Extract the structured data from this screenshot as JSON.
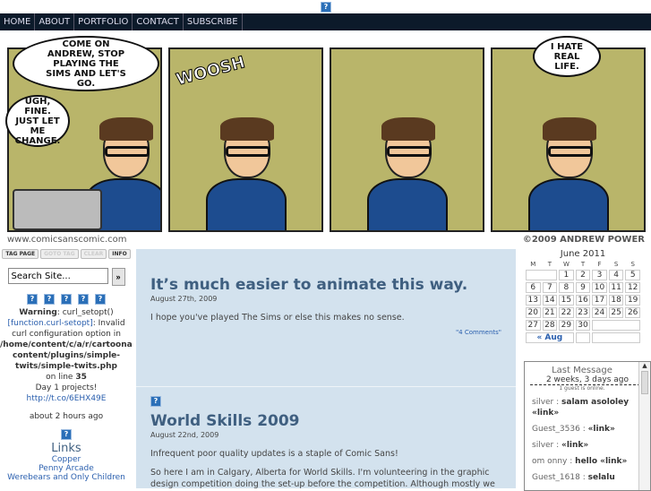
{
  "nav": [
    "HOME",
    "ABOUT",
    "PORTFOLIO",
    "CONTACT",
    "SUBSCRIBE"
  ],
  "comic": {
    "bubble1": "COME ON ANDREW, STOP PLAYING THE SIMS AND LET'S GO.",
    "bubble2": "UGH, FINE. JUST LET ME CHANGE.",
    "sfx": "WOOSH",
    "bubble4": "I HATE REAL LIFE.",
    "site": "www.comicsanscomic.com",
    "copyright": "©2009 ANDREW POWER"
  },
  "toolbar": [
    "TAG PAGE",
    "GOTO TAG",
    "CLEAR",
    "INFO"
  ],
  "search": {
    "placeholder": "Search Site...",
    "button": "»"
  },
  "twitter": {
    "warning_label": "Warning",
    "warning_fn": ": curl_setopt()",
    "fn_link": "[function.curl-setopt]",
    "msg": ": Invalid curl configuration option in",
    "path": "/home/content/c/a/r/cartoonand content/plugins/simple-twits/simple-twits.php",
    "line_label": "on line",
    "line": "35",
    "tweet": "Day 1 projects!",
    "tweet_link": "http://t.co/6EHX49E",
    "time": "about 2 hours ago"
  },
  "links": {
    "title": "Links",
    "items": [
      "Copper",
      "Penny Arcade",
      "Werebears and Only Children"
    ]
  },
  "posts": [
    {
      "title": "It’s much easier to animate this way.",
      "date": "August 27th, 2009",
      "body": "I hope you've played The Sims or else this makes no sense.",
      "comments": "\"4 Comments\""
    },
    {
      "title": "World Skills 2009",
      "date": "August 22nd, 2009",
      "body": "Infrequent poor quality updates is a staple of Comic Sans!",
      "body2": "So here I am in Calgary, Alberta for World Skills. I'm volunteering in the graphic design competition doing the set-up before the competition. Although mostly we"
    }
  ],
  "calendar": {
    "title": "June 2011",
    "days": [
      "M",
      "T",
      "W",
      "T",
      "F",
      "S",
      "S"
    ],
    "weeks": [
      [
        "",
        "",
        "1",
        "2",
        "3",
        "4",
        "5"
      ],
      [
        "6",
        "7",
        "8",
        "9",
        "10",
        "11",
        "12"
      ],
      [
        "13",
        "14",
        "15",
        "16",
        "17",
        "18",
        "19"
      ],
      [
        "20",
        "21",
        "22",
        "23",
        "24",
        "25",
        "26"
      ],
      [
        "27",
        "28",
        "29",
        "30",
        "",
        "",
        ""
      ]
    ],
    "prev": "« Aug"
  },
  "chat": {
    "title": "Last Message",
    "ago": "2 weeks, 3 days ago",
    "online": "1 guest is online.",
    "messages": [
      {
        "user": "silver :",
        "text": "salam asololey «link»"
      },
      {
        "user": "Guest_3536 :",
        "text": "«link»"
      },
      {
        "user": "silver :",
        "text": "«link»"
      },
      {
        "user": "om onny :",
        "text": "hello «link»"
      },
      {
        "user": "Guest_1618 :",
        "text": "selalu"
      }
    ]
  }
}
